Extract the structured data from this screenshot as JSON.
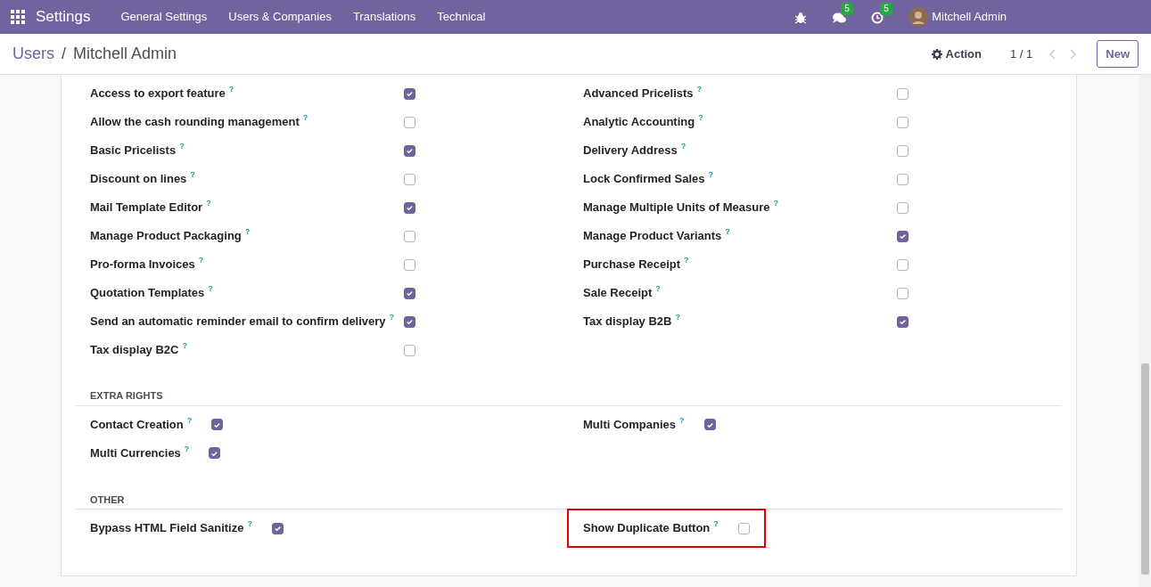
{
  "navbar": {
    "app": "Settings",
    "menu": [
      "General Settings",
      "Users & Companies",
      "Translations",
      "Technical"
    ],
    "messages_count": "5",
    "activities_count": "5",
    "user": "Mitchell Admin"
  },
  "control_panel": {
    "breadcrumb": [
      "Users",
      "Mitchell Admin"
    ],
    "separator": "/",
    "action": "Action",
    "pager": "1 / 1",
    "new_button": "New"
  },
  "sections": [
    {
      "kind": "aligned",
      "columns": [
        [
          {
            "label": "Access to export feature",
            "help": "?",
            "checked": true,
            "highlighted": false
          },
          {
            "label": "Allow the cash rounding management",
            "help": "?",
            "checked": false,
            "highlighted": false
          },
          {
            "label": "Basic Pricelists",
            "help": "?",
            "checked": true,
            "highlighted": false
          },
          {
            "label": "Discount on lines",
            "help": "?",
            "checked": false,
            "highlighted": false
          },
          {
            "label": "Mail Template Editor",
            "help": "?",
            "checked": true,
            "highlighted": false
          },
          {
            "label": "Manage Product Packaging",
            "help": "?",
            "checked": false,
            "highlighted": false
          },
          {
            "label": "Pro-forma Invoices",
            "help": "?",
            "checked": false,
            "highlighted": false
          },
          {
            "label": "Quotation Templates",
            "help": "?",
            "checked": true,
            "highlighted": false
          },
          {
            "label": "Send an automatic reminder email to confirm delivery",
            "help": "?",
            "checked": true,
            "highlighted": false
          },
          {
            "label": "Tax display B2C",
            "help": "?",
            "checked": false,
            "highlighted": false
          }
        ],
        [
          {
            "label": "Advanced Pricelists",
            "help": "?",
            "checked": false,
            "highlighted": false
          },
          {
            "label": "Analytic Accounting",
            "help": "?",
            "checked": false,
            "highlighted": false
          },
          {
            "label": "Delivery Address",
            "help": "?",
            "checked": false,
            "highlighted": false
          },
          {
            "label": "Lock Confirmed Sales",
            "help": "?",
            "checked": false,
            "highlighted": false
          },
          {
            "label": "Manage Multiple Units of Measure",
            "help": "?",
            "checked": false,
            "highlighted": false
          },
          {
            "label": "Manage Product Variants",
            "help": "?",
            "checked": true,
            "highlighted": false
          },
          {
            "label": "Purchase Receipt",
            "help": "?",
            "checked": false,
            "highlighted": false
          },
          {
            "label": "Sale Receipt",
            "help": "?",
            "checked": false,
            "highlighted": false
          },
          {
            "label": "Tax display B2B",
            "help": "?",
            "checked": true,
            "highlighted": false
          }
        ]
      ]
    },
    {
      "kind": "inline",
      "title": "EXTRA RIGHTS",
      "columns": [
        [
          {
            "label": "Contact Creation",
            "help": "?",
            "checked": true,
            "highlighted": false
          },
          {
            "label": "Multi Currencies",
            "help": "?",
            "checked": true,
            "highlighted": false
          }
        ],
        [
          {
            "label": "Multi Companies",
            "help": "?",
            "checked": true,
            "highlighted": false
          }
        ]
      ]
    },
    {
      "kind": "inline",
      "title": "OTHER",
      "columns": [
        [
          {
            "label": "Bypass HTML Field Sanitize",
            "help": "?",
            "checked": true,
            "highlighted": false
          }
        ],
        [
          {
            "label": "Show Duplicate Button",
            "help": "?",
            "checked": false,
            "highlighted": true
          }
        ]
      ]
    }
  ]
}
